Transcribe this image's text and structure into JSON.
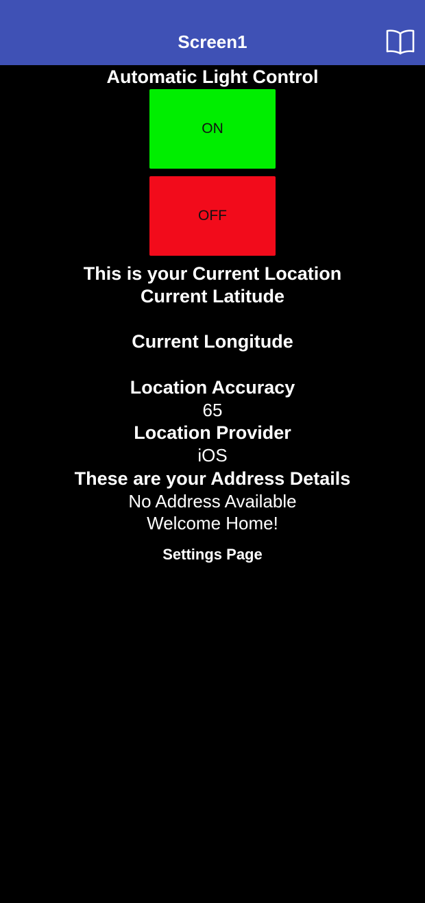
{
  "titlebar": {
    "title": "Screen1",
    "icon": "book-icon"
  },
  "heading": "Automatic Light Control",
  "buttons": {
    "on_label": "ON",
    "off_label": "OFF",
    "on_color": "#00ee00",
    "off_color": "#f20b1b"
  },
  "location": {
    "heading": "This is your Current Location",
    "latitude_label": "Current Latitude",
    "latitude_value": "",
    "longitude_label": "Current Longitude",
    "longitude_value": "",
    "accuracy_label": "Location Accuracy",
    "accuracy_value": "65",
    "provider_label": "Location Provider",
    "provider_value": "iOS"
  },
  "address": {
    "heading": "These are your Address Details",
    "value": "No Address Available",
    "welcome": "Welcome Home!"
  },
  "settings_label": "Settings Page",
  "colors": {
    "titlebar": "#3f51b5",
    "background": "#000000",
    "text": "#ffffff"
  }
}
